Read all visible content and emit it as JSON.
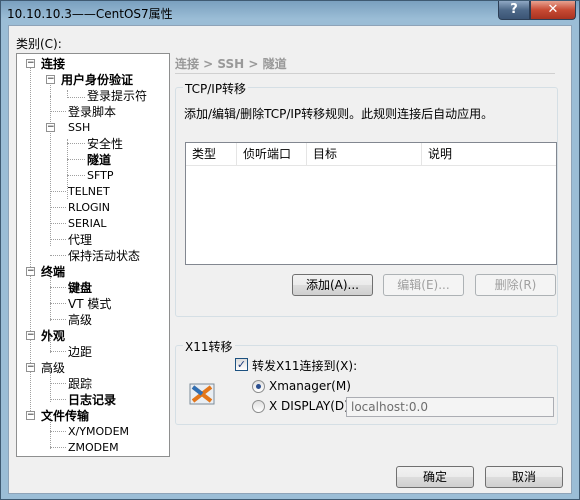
{
  "window": {
    "title": "10.10.10.3——CentOS7属性",
    "help_label": "?",
    "close_label": "✕"
  },
  "category_label": "类别(C):",
  "tree": {
    "connect": "连接",
    "user_auth": "用户身份验证",
    "login_prompt": "登录提示符",
    "login_script": "登录脚本",
    "ssh": "SSH",
    "security": "安全性",
    "tunnel": "隧道",
    "sftp": "SFTP",
    "telnet": "TELNET",
    "rlogin": "RLOGIN",
    "serial": "SERIAL",
    "proxy": "代理",
    "keepalive": "保持活动状态",
    "terminal": "终端",
    "keyboard": "键盘",
    "vt_mode": "VT 模式",
    "advanced": "高级",
    "appearance": "外观",
    "margin": "边距",
    "advanced2": "高级",
    "trace": "跟踪",
    "log": "日志记录",
    "file_transfer": "文件传输",
    "xymodem": "X/YMODEM",
    "zmodem": "ZMODEM"
  },
  "breadcrumb": "连接 > SSH > 隧道",
  "tcpip": {
    "group_title": "TCP/IP转移",
    "description": "添加/编辑/删除TCP/IP转移规则。此规则连接后自动应用。",
    "columns": [
      "类型",
      "侦听端口",
      "目标",
      "说明"
    ],
    "add_label": "添加(A)...",
    "edit_label": "编辑(E)...",
    "delete_label": "删除(R)"
  },
  "x11": {
    "group_title": "X11转移",
    "forward_label": "转发X11连接到(X):",
    "forward_checked": true,
    "xmanager_label": "Xmanager(M)",
    "xdisplay_label": "X DISPLAY(D):",
    "xdisplay_value": "localhost:0.0",
    "selected": "Xmanager(M)"
  },
  "footer": {
    "ok_label": "确定",
    "cancel_label": "取消"
  }
}
